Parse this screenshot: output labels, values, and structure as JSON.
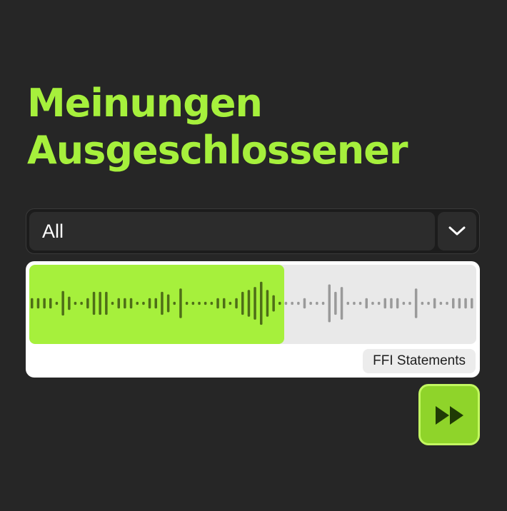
{
  "title": {
    "line1": "Meinungen",
    "line2": "Ausgeschlossener"
  },
  "selector": {
    "value": "All",
    "toggle_icon": "chevron-down-icon"
  },
  "player": {
    "progress": 0.57,
    "source_label": "FFI Statements",
    "waveform_amplitudes": [
      0.14,
      0.14,
      0.14,
      0.14,
      0.04,
      0.33,
      0.18,
      0.04,
      0.04,
      0.14,
      0.31,
      0.31,
      0.31,
      0.04,
      0.14,
      0.14,
      0.14,
      0.04,
      0.04,
      0.14,
      0.14,
      0.31,
      0.24,
      0.04,
      0.4,
      0.04,
      0.04,
      0.04,
      0.04,
      0.04,
      0.14,
      0.14,
      0.04,
      0.14,
      0.31,
      0.36,
      0.44,
      0.58,
      0.36,
      0.22,
      0.04,
      0.04,
      0.04,
      0.04,
      0.14,
      0.04,
      0.04,
      0.04,
      0.51,
      0.31,
      0.44,
      0.04,
      0.04,
      0.04,
      0.14,
      0.04,
      0.04,
      0.14,
      0.14,
      0.14,
      0.04,
      0.04,
      0.4,
      0.04,
      0.04,
      0.14,
      0.04,
      0.04,
      0.14,
      0.14,
      0.14,
      0.14
    ]
  },
  "controls": {
    "forward_icon": "fast-forward-icon"
  },
  "colors": {
    "background": "#262626",
    "accent": "#a6f03c",
    "played_bar": "#4e6e17",
    "unplayed_bar": "#9a9a9a",
    "button": "#8fd42a"
  }
}
